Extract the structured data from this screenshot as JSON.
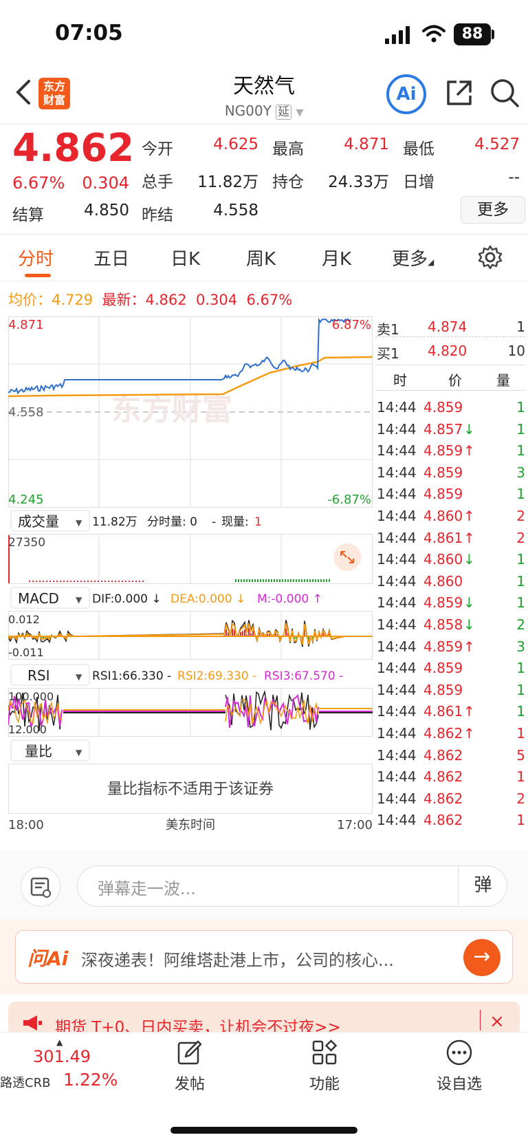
{
  "status": {
    "time": "07:05",
    "battery": "88"
  },
  "header": {
    "title": "天然气",
    "code": "NG00Y",
    "delay_tag": "延",
    "logo_line1": "东方",
    "logo_line2": "财富",
    "ai_label": "Ai"
  },
  "quote": {
    "price": "4.862",
    "change_pct": "6.67%",
    "change_val": "0.304",
    "open_label": "今开",
    "open": "4.625",
    "high_label": "最高",
    "high": "4.871",
    "low_label": "最低",
    "low": "4.527",
    "volume_label": "总手",
    "volume": "11.82万",
    "oi_label": "持仓",
    "oi": "24.33万",
    "daily_inc_label": "日增",
    "daily_inc": "--",
    "settle_label": "结算",
    "settle": "4.850",
    "prev_settle_label": "昨结",
    "prev_settle": "4.558",
    "more_label": "更多"
  },
  "tabs": [
    "分时",
    "五日",
    "日K",
    "周K",
    "月K",
    "更多"
  ],
  "avg_line": {
    "avg_label": "均价：",
    "avg": "4.729",
    "latest_label": "最新：",
    "latest": "4.862",
    "chg": "0.304",
    "pct": "6.67%"
  },
  "main_chart": {
    "top_label": "4.871",
    "top_pct": "6.87%",
    "mid_label": "4.558",
    "bottom_label": "4.245",
    "bottom_pct": "-6.87%",
    "watermark": "东方财富"
  },
  "volume_panel": {
    "selector": "成交量",
    "total": "11.82万",
    "period_label": "分时量: 0",
    "sep": "-",
    "now_label": "现量:",
    "now": "1",
    "max": "27350"
  },
  "macd_panel": {
    "selector": "MACD",
    "dif": "DIF:0.000 ↓",
    "dea": "DEA:0.000 ↓",
    "m": "M:-0.000 ↑",
    "top": "0.012",
    "bottom": "-0.011"
  },
  "rsi_panel": {
    "selector": "RSI",
    "rsi1": "RSI1:66.330 -",
    "rsi2": "RSI2:69.330 -",
    "rsi3": "RSI3:67.570 -",
    "top": "100.000",
    "bottom": "12.000"
  },
  "ratio_panel": {
    "selector": "量比",
    "message": "量比指标不适用于该证券"
  },
  "time_axis": {
    "start": "18:00",
    "mid": "美东时间",
    "end": "17:00"
  },
  "orderbook": {
    "ask": {
      "label": "卖1",
      "price": "4.874",
      "qty": "1"
    },
    "bid": {
      "label": "买1",
      "price": "4.820",
      "qty": "10"
    },
    "headers": [
      "时",
      "价",
      "量"
    ]
  },
  "trades": [
    {
      "t": "14:44",
      "p": "4.859",
      "a": "",
      "q": "1",
      "qc": "green"
    },
    {
      "t": "14:44",
      "p": "4.857",
      "a": "↓",
      "q": "1",
      "qc": "green"
    },
    {
      "t": "14:44",
      "p": "4.859",
      "a": "↑",
      "q": "1",
      "qc": "green"
    },
    {
      "t": "14:44",
      "p": "4.859",
      "a": "",
      "q": "3",
      "qc": "green"
    },
    {
      "t": "14:44",
      "p": "4.859",
      "a": "",
      "q": "1",
      "qc": "green"
    },
    {
      "t": "14:44",
      "p": "4.860",
      "a": "↑",
      "q": "2",
      "qc": "red"
    },
    {
      "t": "14:44",
      "p": "4.861",
      "a": "↑",
      "q": "2",
      "qc": "red"
    },
    {
      "t": "14:44",
      "p": "4.860",
      "a": "↓",
      "q": "1",
      "qc": "green"
    },
    {
      "t": "14:44",
      "p": "4.860",
      "a": "",
      "q": "1",
      "qc": "green"
    },
    {
      "t": "14:44",
      "p": "4.859",
      "a": "↓",
      "q": "1",
      "qc": "green"
    },
    {
      "t": "14:44",
      "p": "4.858",
      "a": "↓",
      "q": "2",
      "qc": "green"
    },
    {
      "t": "14:44",
      "p": "4.859",
      "a": "↑",
      "q": "3",
      "qc": "green"
    },
    {
      "t": "14:44",
      "p": "4.859",
      "a": "",
      "q": "1",
      "qc": "green"
    },
    {
      "t": "14:44",
      "p": "4.859",
      "a": "",
      "q": "1",
      "qc": "green"
    },
    {
      "t": "14:44",
      "p": "4.861",
      "a": "↑",
      "q": "1",
      "qc": "green"
    },
    {
      "t": "14:44",
      "p": "4.862",
      "a": "↑",
      "q": "1",
      "qc": "red"
    },
    {
      "t": "14:44",
      "p": "4.862",
      "a": "",
      "q": "5",
      "qc": "red"
    },
    {
      "t": "14:44",
      "p": "4.862",
      "a": "",
      "q": "1",
      "qc": "red"
    },
    {
      "t": "14:44",
      "p": "4.862",
      "a": "",
      "q": "2",
      "qc": "red"
    },
    {
      "t": "14:44",
      "p": "4.862",
      "a": "",
      "q": "1",
      "qc": "red"
    }
  ],
  "danmu": {
    "placeholder": "弹幕走一波...",
    "button": "弹"
  },
  "ai_banner": {
    "logo": "问Ai",
    "text": "深夜递表！阿维塔赴港上市，公司的核心...",
    "arrow": "→"
  },
  "promo": {
    "text": "期货 T+0、日内买卖，让机会不过夜>>",
    "close": "×"
  },
  "tabbar": {
    "index_value": "301.49",
    "index_name": "路透CRB",
    "index_pct": "1.22%",
    "items": [
      "发帖",
      "功能",
      "设自选"
    ]
  },
  "colors": {
    "red": "#e6252d",
    "green": "#1fa22e",
    "orange": "#f59a12",
    "blue": "#2f6fce",
    "brand": "#f35b1a"
  }
}
